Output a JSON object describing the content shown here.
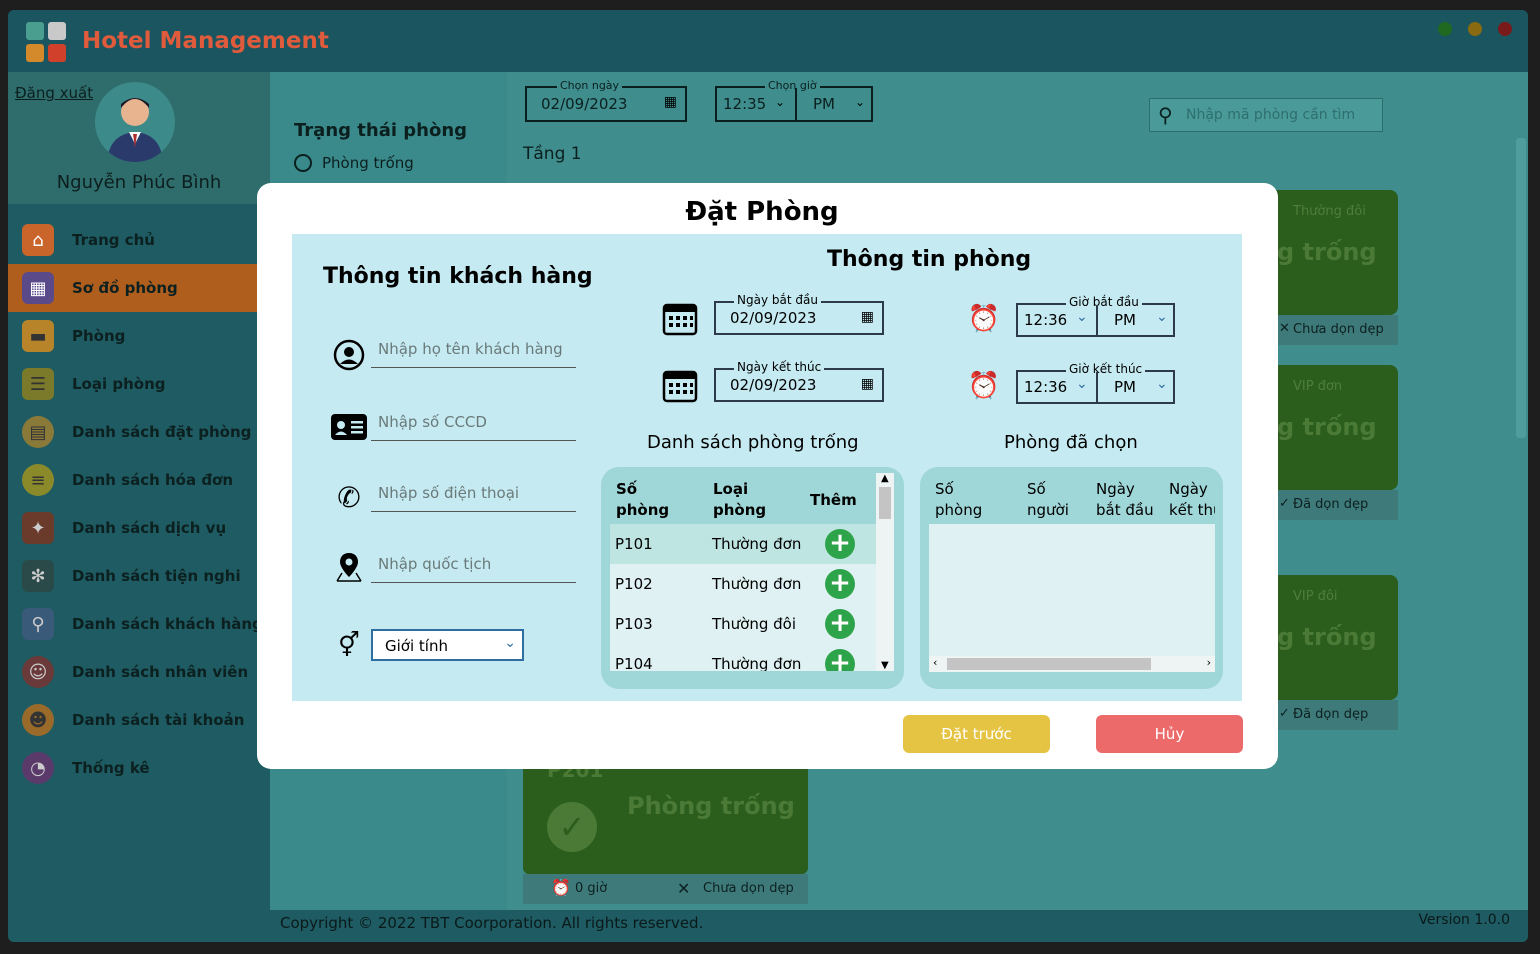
{
  "app": {
    "title": "Hotel Management"
  },
  "sidebar": {
    "logout": "Đăng xuất",
    "username": "Nguyễn Phúc Bình",
    "items": [
      {
        "label": "Trang chủ",
        "icon": "home-icon"
      },
      {
        "label": "Sơ đồ phòng",
        "icon": "room-map-icon"
      },
      {
        "label": "Phòng",
        "icon": "room-icon"
      },
      {
        "label": "Loại phòng",
        "icon": "room-type-icon"
      },
      {
        "label": "Danh sách đặt phòng",
        "icon": "booking-list-icon"
      },
      {
        "label": "Danh sách hóa đơn",
        "icon": "invoice-list-icon"
      },
      {
        "label": "Danh sách dịch vụ",
        "icon": "service-list-icon"
      },
      {
        "label": "Danh sách tiện nghi",
        "icon": "amenity-list-icon"
      },
      {
        "label": "Danh sách khách hàng",
        "icon": "customer-list-icon"
      },
      {
        "label": "Danh sách nhân viên",
        "icon": "staff-list-icon"
      },
      {
        "label": "Danh sách tài khoản",
        "icon": "account-list-icon"
      },
      {
        "label": "Thống kê",
        "icon": "stats-icon"
      }
    ]
  },
  "filter": {
    "title": "Trạng thái phòng",
    "option1": "Phòng trống"
  },
  "main": {
    "date_label": "Chọn ngày",
    "date_value": "02/09/2023",
    "time_label": "Chọn giờ",
    "time_value": "12:35",
    "ampm": "PM",
    "search_placeholder": "Nhập mã phòng cần tìm",
    "floor": "Tầng 1",
    "cards": [
      {
        "type": "Thường đôi",
        "status": "g trống",
        "clean": "Chưa dọn dẹp"
      },
      {
        "type": "VIP đơn",
        "status": "g trống",
        "clean": "Đã dọn dẹp"
      },
      {
        "type": "VIP đôi",
        "status": "g trống",
        "clean": "Đã dọn dẹp"
      }
    ],
    "bottom_card": {
      "code": "P201",
      "status": "Phòng trống",
      "hours": "0 giờ",
      "clean": "Chưa dọn dẹp"
    }
  },
  "footer": {
    "copyright": "Copyright © 2022 TBT Coorporation. All rights reserved.",
    "version": "Version 1.0.0"
  },
  "modal": {
    "title": "Đặt Phòng",
    "customer": {
      "heading": "Thông tin khách hàng",
      "name_placeholder": "Nhập họ tên khách hàng",
      "id_placeholder": "Nhập số CCCD",
      "phone_placeholder": "Nhập số điện thoại",
      "nationality_placeholder": "Nhập quốc tịch",
      "gender": "Giới tính"
    },
    "room": {
      "heading": "Thông tin phòng",
      "start_date_label": "Ngày bắt đầu",
      "start_date": "02/09/2023",
      "end_date_label": "Ngày kết thúc",
      "end_date": "02/09/2023",
      "start_time_label": "Giờ bắt đầu",
      "start_time": "12:36",
      "start_ampm": "PM",
      "end_time_label": "Giờ kết thúc",
      "end_time": "12:36",
      "end_ampm": "PM"
    },
    "available": {
      "heading": "Danh sách phòng trống",
      "headers": [
        "Số\nphòng",
        "Loại\nphòng",
        "Thêm"
      ],
      "rows": [
        {
          "code": "P101",
          "type": "Thường đơn"
        },
        {
          "code": "P102",
          "type": "Thường đơn"
        },
        {
          "code": "P103",
          "type": "Thường đôi"
        },
        {
          "code": "P104",
          "type": "Thường đơn"
        }
      ]
    },
    "selected": {
      "heading": "Phòng đã chọn",
      "headers": [
        "Số\nphòng",
        "Số\nngười",
        "Ngày\nbắt đầu",
        "Ngày\nkết thú"
      ]
    },
    "buttons": {
      "book": "Đặt trước",
      "cancel": "Hủy"
    },
    "colors": {
      "book": "#e6c443",
      "cancel": "#ec6a6a",
      "panel": "#c5eaf1",
      "add": "#2ea44a"
    }
  }
}
